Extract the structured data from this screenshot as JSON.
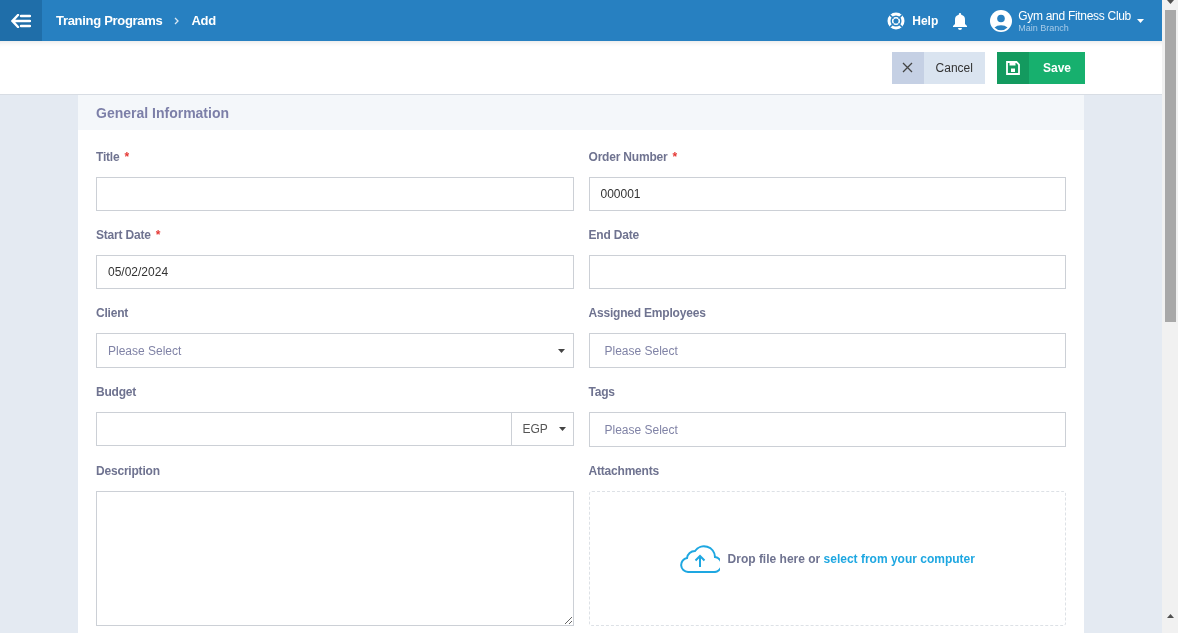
{
  "header": {
    "breadcrumb": [
      "Traning Programs",
      "Add"
    ],
    "help": "Help",
    "account": {
      "name": "Gym and Fitness Club",
      "branch": "Main Branch"
    }
  },
  "actions": {
    "cancel": "Cancel",
    "save": "Save"
  },
  "section": {
    "title": "General Information"
  },
  "fields": [
    {
      "kind": "text",
      "label": "Title",
      "required_mark": "*"
    },
    {
      "kind": "text",
      "label": "Order Number",
      "required_mark": "*",
      "value": "000001"
    },
    {
      "kind": "text",
      "label": "Start Date",
      "required_mark": "*",
      "value": "05/02/2024"
    },
    {
      "kind": "text",
      "label": "End Date"
    },
    {
      "kind": "select",
      "label": "Client",
      "placeholder": "Please Select"
    },
    {
      "kind": "multiselect",
      "label": "Assigned Employees",
      "placeholder": "Please Select"
    },
    {
      "kind": "money",
      "label": "Budget",
      "currency": "EGP"
    },
    {
      "kind": "multiselect",
      "label": "Tags",
      "placeholder": "Please Select"
    },
    {
      "kind": "textarea",
      "label": "Description"
    },
    {
      "kind": "dropzone",
      "label": "Attachments",
      "text": "Drop file here or",
      "link": "select from your computer"
    }
  ]
}
